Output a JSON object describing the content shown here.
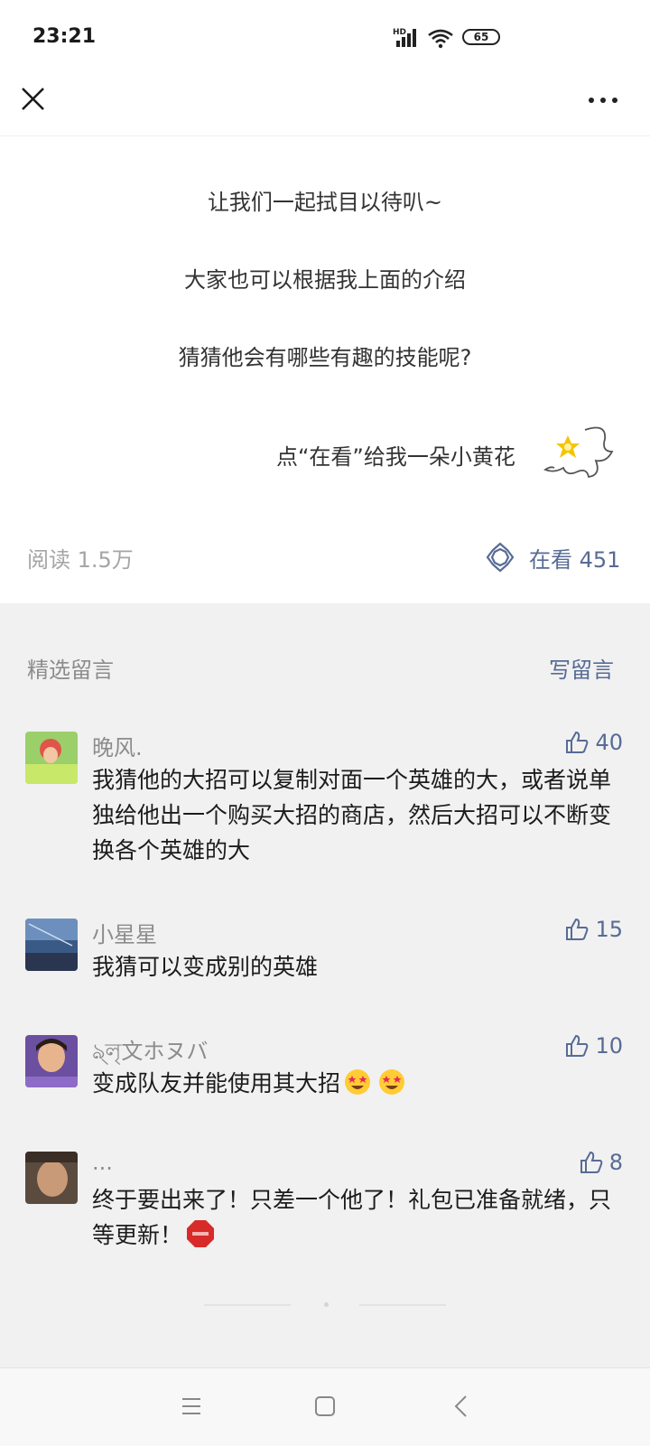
{
  "status_bar": {
    "time": "23:21",
    "network_label": "HD",
    "battery_level": "65"
  },
  "nav": {
    "close_icon": "close-icon",
    "more_icon": "more-icon"
  },
  "article": {
    "lines": [
      "让我们一起拭目以待叭~",
      "大家也可以根据我上面的介绍",
      "猜猜他会有哪些有趣的技能呢?",
      "点“在看”给我一朵小黄花"
    ],
    "reads": "阅读 1.5万",
    "watching": "在看 451",
    "accent_color": "#576b95"
  },
  "comments_section": {
    "title": "精选留言",
    "write_label": "写留言",
    "comments": [
      {
        "name": "晚风.",
        "likes": "40",
        "text": "我猜他的大招可以复制对面一个英雄的大，或者说单独给他出一个购买大招的商店，然后大招可以不断变换各个英雄的大"
      },
      {
        "name": "小星星",
        "likes": "15",
        "text": "我猜可以变成别的英雄"
      },
      {
        "name": "ঌ্লৃ文ホヌバ",
        "likes": "10",
        "text": "变成队友并能使用其大招"
      },
      {
        "name": "...",
        "likes": "8",
        "text": "终于要出来了！只差一个他了！礼包已准备就绪，只等更新！"
      }
    ]
  },
  "system_nav": {
    "menu_icon": "menu-icon",
    "home_icon": "home-icon",
    "back_icon": "back-icon"
  }
}
